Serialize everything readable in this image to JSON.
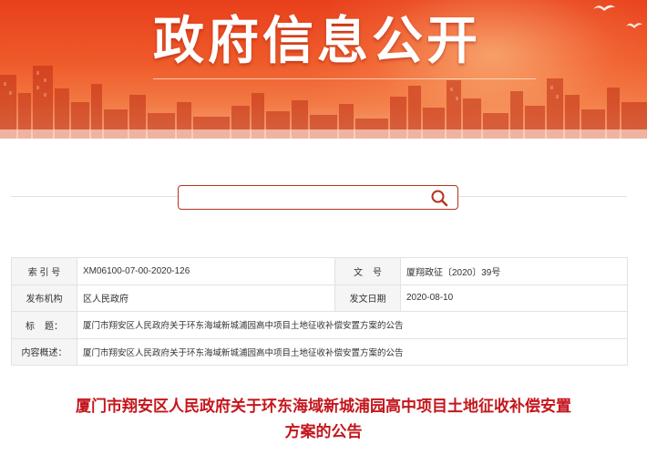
{
  "banner": {
    "title": "政府信息公开"
  },
  "search": {
    "value": "",
    "placeholder": ""
  },
  "info": {
    "index_label": "索 引 号",
    "index_value": "XM06100-07-00-2020-126",
    "docno_label": "文    号",
    "docno_value": "厦翔政征〔2020〕39号",
    "issuer_label": "发布机构",
    "issuer_value": "区人民政府",
    "date_label": "发文日期",
    "date_value": "2020-08-10",
    "title_label": "标    题：",
    "title_value": "厦门市翔安区人民政府关于环东海域新城浦园高中项目土地征收补偿安置方案的公告",
    "summary_label": "内容概述：",
    "summary_value": "厦门市翔安区人民政府关于环东海域新城浦园高中项目土地征收补偿安置方案的公告"
  },
  "article": {
    "title_line1": "厦门市翔安区人民政府关于环东海域新城浦园高中项目土地征收补偿安置",
    "title_line2": "方案的公告"
  },
  "colors": {
    "accent_red": "#c4161c",
    "banner_orange": "#ef5a2a",
    "search_border": "#b8321e"
  }
}
